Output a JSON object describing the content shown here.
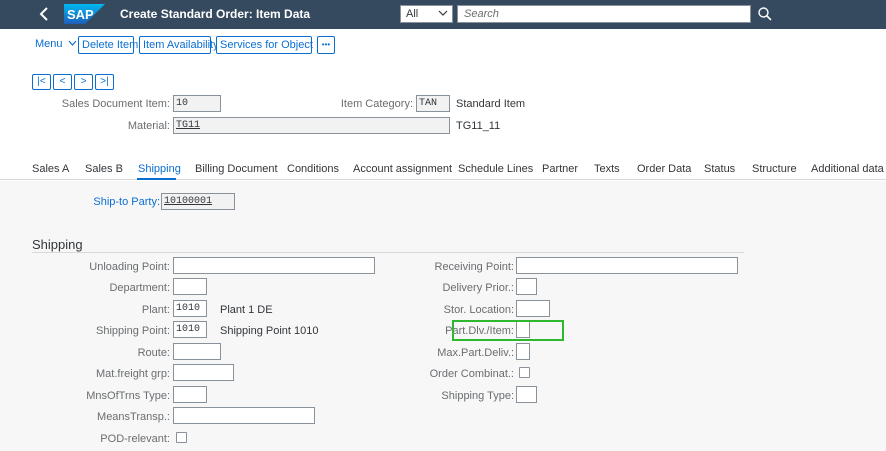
{
  "shell": {
    "title": "Create Standard Order: Item Data",
    "scope": "All",
    "search_placeholder": "Search",
    "logo_text": "SAP"
  },
  "toolbar": {
    "menu": "Menu",
    "delete_item": "Delete Item",
    "item_availability": "Item Availability",
    "services_for_object": "Services for Object",
    "more": "•••"
  },
  "nav": {
    "first": "|<",
    "prev": "<",
    "next": ">",
    "last": ">|"
  },
  "header": {
    "sales_doc_item_label": "Sales Document Item:",
    "sales_doc_item_value": "10",
    "item_category_label": "Item Category:",
    "item_category_value": "TAN",
    "item_category_text": "Standard Item",
    "material_label": "Material:",
    "material_value": "TG11",
    "material_text": "TG11_11"
  },
  "tabs": [
    "Sales A",
    "Sales B",
    "Shipping",
    "Billing Document",
    "Conditions",
    "Account assignment",
    "Schedule Lines",
    "Partner",
    "Texts",
    "Order Data",
    "Status",
    "Structure",
    "Additional data A"
  ],
  "ship_to": {
    "label": "Ship-to Party:",
    "value": "10100001"
  },
  "shipping": {
    "title": "Shipping",
    "unloading_point": "Unloading Point:",
    "department": "Department:",
    "plant_label": "Plant:",
    "plant_value": "1010",
    "plant_text": "Plant 1 DE",
    "shipping_point_label": "Shipping Point:",
    "shipping_point_value": "1010",
    "shipping_point_text": "Shipping Point 1010",
    "route": "Route:",
    "mat_freight_grp": "Mat.freight grp:",
    "mns_of_trns_type": "MnsOfTrns Type:",
    "means_transp": "MeansTransp.:",
    "pod_relevant": "POD-relevant:",
    "receiving_point": "Receiving Point:",
    "delivery_prior": "Delivery Prior.:",
    "stor_location": "Stor. Location:",
    "part_dlv_item": "Part.Dlv./Item:",
    "max_part_deliv": "Max.Part.Deliv.:",
    "order_combinat": "Order Combinat.:",
    "shipping_type": "Shipping Type:"
  }
}
